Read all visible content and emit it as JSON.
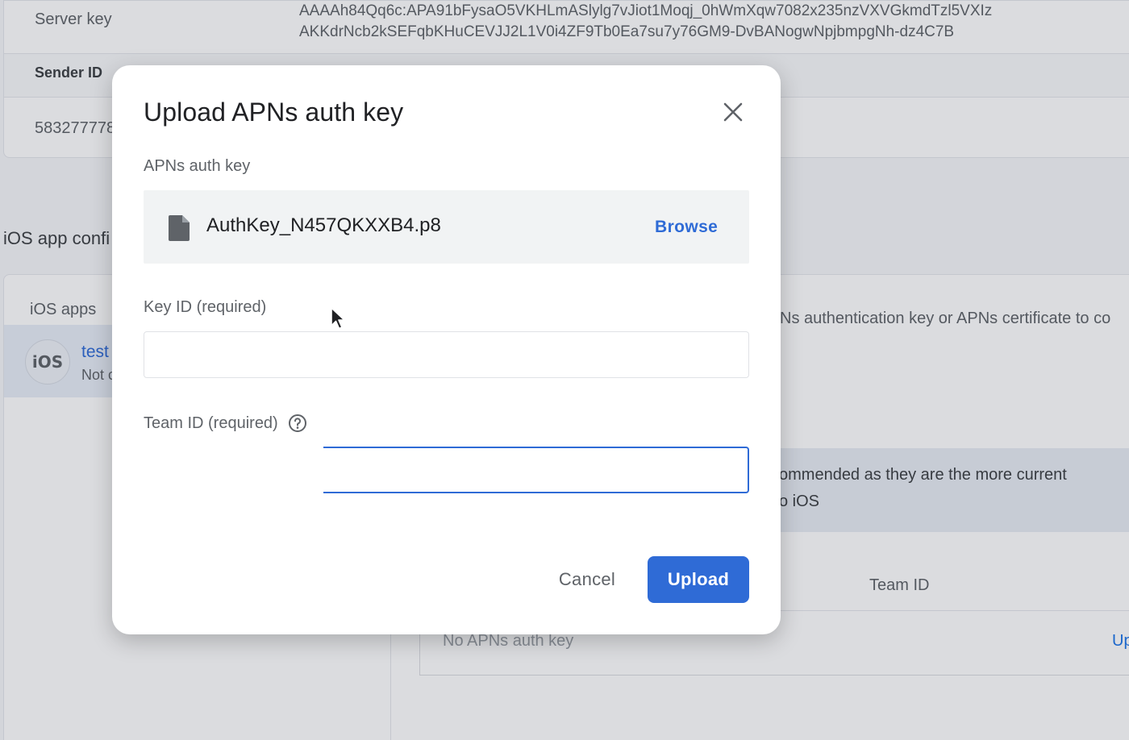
{
  "background": {
    "server_key_label": "Server key",
    "server_key_line1": "AAAAh84Qq6c:APA91bFysaO5VKHLmASlylg7vJiot1Moqj_0hWmXqw7082x235nzVXVGkmdTzl5VXIz",
    "server_key_line2": "AKKdrNcb2kSEFqbKHuCEVJJ2L1V0i4ZF9Tb0Ea7su7y76GM9-DvBANogwNpjbmpgNh-dz4C7B",
    "sender_id_label": "Sender ID",
    "sender_id_value": "583277778",
    "section_title": "iOS app confi",
    "ios_apps_label": "iOS apps",
    "ios_badge": "iOS",
    "app_name": "test",
    "app_status": "Not c",
    "right_text_1": "Ns authentication key or APNs certificate to co",
    "right_text_2": "ommended as they are the more current",
    "right_text_3": "o iOS",
    "team_id_header": "Team ID",
    "no_key_text": "No APNs auth key",
    "upload_link": "Up"
  },
  "dialog": {
    "title": "Upload APNs auth key",
    "apns_label": "APNs auth key",
    "file_name": "AuthKey_N457QKXXB4.p8",
    "browse_label": "Browse",
    "key_id_label": "Key ID (required)",
    "key_id_value": "",
    "team_id_label": "Team ID (required)",
    "team_id_value": "",
    "cancel_label": "Cancel",
    "upload_label": "Upload"
  },
  "colors": {
    "accent": "#2f6bd6",
    "scrim": "rgba(32,40,56,0.16)"
  },
  "icons": [
    "close-icon",
    "file-icon",
    "help-icon",
    "mouse-pointer-icon"
  ]
}
